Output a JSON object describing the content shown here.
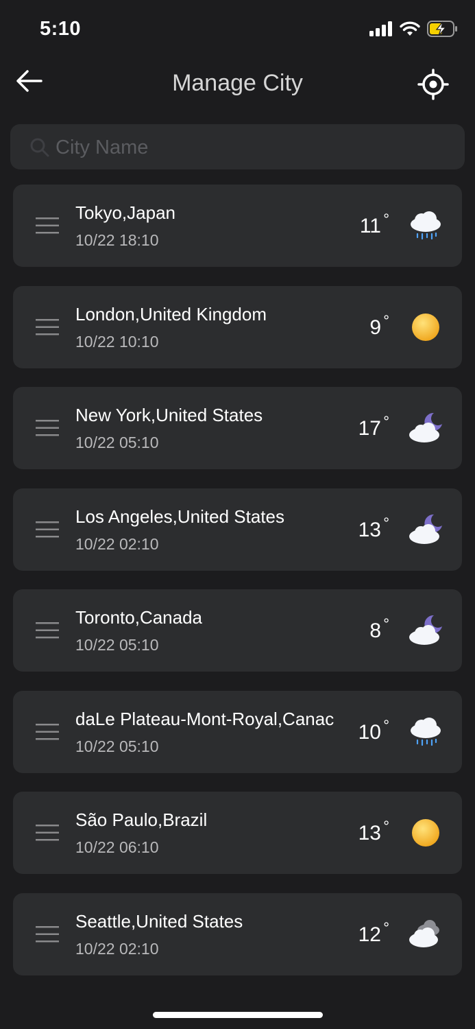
{
  "status_bar": {
    "time": "5:10"
  },
  "header": {
    "title": "Manage City"
  },
  "search": {
    "placeholder": "City Name",
    "value": ""
  },
  "cities": [
    {
      "name": "Tokyo,Japan",
      "time": "10/22 18:10",
      "temp": "11",
      "degree": "°",
      "weather_icon": "rain-cloud-icon"
    },
    {
      "name": "London,United Kingdom",
      "time": "10/22 10:10",
      "temp": "9",
      "degree": "°",
      "weather_icon": "sun-icon"
    },
    {
      "name": "New York,United States",
      "time": "10/22 05:10",
      "temp": "17",
      "degree": "°",
      "weather_icon": "cloudy-night-icon"
    },
    {
      "name": "Los Angeles,United States",
      "time": "10/22 02:10",
      "temp": "13",
      "degree": "°",
      "weather_icon": "cloudy-night-icon"
    },
    {
      "name": "Toronto,Canada",
      "time": "10/22 05:10",
      "temp": "8",
      "degree": "°",
      "weather_icon": "cloudy-night-icon"
    },
    {
      "name": "daLe Plateau-Mont-Royal,Canac",
      "time": "10/22 05:10",
      "temp": "10",
      "degree": "°",
      "weather_icon": "rain-cloud-icon"
    },
    {
      "name": "São Paulo,Brazil",
      "time": "10/22 06:10",
      "temp": "13",
      "degree": "°",
      "weather_icon": "sun-icon"
    },
    {
      "name": "Seattle,United States",
      "time": "10/22 02:10",
      "temp": "12",
      "degree": "°",
      "weather_icon": "overcast-cloud-icon"
    }
  ],
  "colors": {
    "background": "#1c1c1e",
    "card": "#2c2d2f",
    "battery_charge": "#f5d000",
    "rain_drop": "#4fa3f7",
    "sun": "#f6c63a",
    "moon": "#7d6fc9"
  }
}
